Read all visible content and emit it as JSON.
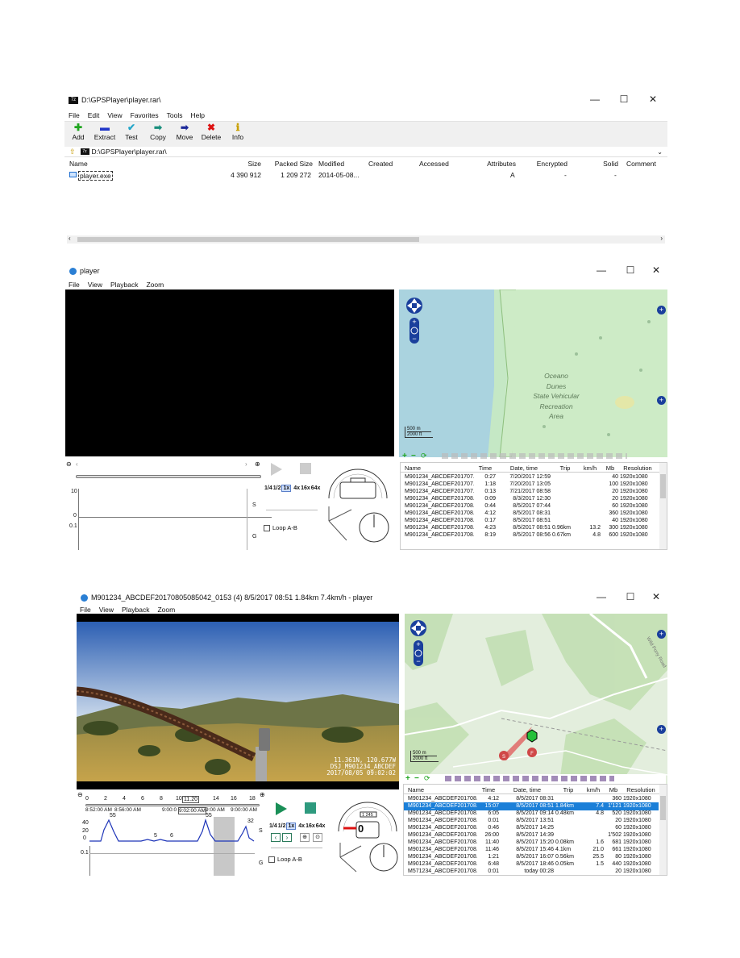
{
  "rar_window": {
    "title": "D:\\GPSPlayer\\player.rar\\",
    "menu": [
      "File",
      "Edit",
      "View",
      "Favorites",
      "Tools",
      "Help"
    ],
    "toolbar": [
      {
        "label": "Add",
        "icon": "plus-icon",
        "glyph": "✚",
        "color": "#1fa51f"
      },
      {
        "label": "Extract",
        "icon": "minus-icon",
        "glyph": "▬",
        "color": "#2036c8"
      },
      {
        "label": "Test",
        "icon": "check-icon",
        "glyph": "✔",
        "color": "#23a6c9"
      },
      {
        "label": "Copy",
        "icon": "copy-arrow-icon",
        "glyph": "➡",
        "color": "#1a8f7d"
      },
      {
        "label": "Move",
        "icon": "move-arrow-icon",
        "glyph": "➡",
        "color": "#1d2a9a"
      },
      {
        "label": "Delete",
        "icon": "delete-x-icon",
        "glyph": "✖",
        "color": "#d11"
      },
      {
        "label": "Info",
        "icon": "info-icon",
        "glyph": "ℹ",
        "color": "#c8a000"
      }
    ],
    "path": "D:\\GPSPlayer\\player.rar\\",
    "columns": [
      "Name",
      "Size",
      "Packed Size",
      "Modified",
      "Created",
      "Accessed",
      "Attributes",
      "Encrypted",
      "Solid",
      "Comment"
    ],
    "file": {
      "name": "player.exe",
      "size": "4 390 912",
      "packed": "1 209 272",
      "modified": "2014-05-08...",
      "attributes": "A",
      "encrypted": "-",
      "solid": "-"
    }
  },
  "player1": {
    "title": "player",
    "menu": [
      "File",
      "View",
      "Playback",
      "Zoom"
    ],
    "map_labels": [
      "Oceano",
      "Dunes",
      "State Vehicular",
      "Recreation",
      "Area"
    ],
    "scale": [
      "500 m",
      "2000 ft"
    ],
    "speeds": [
      "1/4",
      "1/2",
      "1x",
      "4x",
      "16x",
      "64x"
    ],
    "loop_label": "Loop A-B",
    "chart_s_max": "10",
    "chart_s_min": "0",
    "chart_g_max": "0.1",
    "chart_s_label": "S",
    "chart_g_label": "G",
    "list_columns": [
      "Name",
      "Time",
      "Date, time",
      "Trip",
      "km/h",
      "Mb",
      "Resolution"
    ],
    "rows": [
      {
        "name": "M901234_ABCDEF201707...",
        "time": "0:27",
        "date": "7/20/2017 12:59",
        "trip": "",
        "kmh": "",
        "mb": "40",
        "res": "1920x1080"
      },
      {
        "name": "M901234_ABCDEF201707...",
        "time": "1:18",
        "date": "7/20/2017 13:05",
        "trip": "",
        "kmh": "",
        "mb": "100",
        "res": "1920x1080"
      },
      {
        "name": "M901234_ABCDEF201707...",
        "time": "0:13",
        "date": "7/21/2017 08:58",
        "trip": "",
        "kmh": "",
        "mb": "20",
        "res": "1920x1080"
      },
      {
        "name": "M901234_ABCDEF201708...",
        "time": "0:09",
        "date": "8/3/2017 12:30",
        "trip": "",
        "kmh": "",
        "mb": "20",
        "res": "1920x1080"
      },
      {
        "name": "M901234_ABCDEF201708...",
        "time": "0:44",
        "date": "8/5/2017 07:44",
        "trip": "",
        "kmh": "",
        "mb": "60",
        "res": "1920x1080"
      },
      {
        "name": "M901234_ABCDEF201708...",
        "time": "4:12",
        "date": "8/5/2017 08:31",
        "trip": "",
        "kmh": "",
        "mb": "360",
        "res": "1920x1080"
      },
      {
        "name": "M901234_ABCDEF201708...",
        "time": "0:17",
        "date": "8/5/2017 08:51",
        "trip": "",
        "kmh": "",
        "mb": "40",
        "res": "1920x1080"
      },
      {
        "name": "M901234_ABCDEF201708...",
        "time": "4:23",
        "date": "8/5/2017 08:51",
        "trip": "0.96km",
        "kmh": "13.2",
        "mb": "300",
        "res": "1920x1080"
      },
      {
        "name": "M901234_ABCDEF201708...",
        "time": "8:19",
        "date": "8/5/2017 08:56",
        "trip": "0.67km",
        "kmh": "4.8",
        "mb": "600",
        "res": "1920x1080"
      }
    ]
  },
  "player2": {
    "title": "M901234_ABCDEF20170805085042_0153 (4)   8/5/2017 08:51   1.84km   7.4km/h  - player",
    "menu": [
      "File",
      "View",
      "Playback",
      "Zoom"
    ],
    "overlay_line1": "11.361N, 120.677W",
    "overlay_line2": "DSJ_M901234_ABCDEF",
    "overlay_line3": "2017/08/05 09:02:02",
    "road_label": "Wild Pony Road",
    "scale": [
      "500 m",
      "2000 ft"
    ],
    "speedo_value": "0",
    "odo_value": "1 245",
    "ticks": [
      "0",
      "2",
      "4",
      "6",
      "8",
      "10",
      "11.20",
      "14",
      "16",
      "18"
    ],
    "times": [
      "8:52:00 AM",
      "8:56:00 AM",
      "9:00:0",
      "9:02:00 AM",
      "9:00 AM",
      "9:00:00 AM"
    ],
    "peaks": [
      "55",
      "5",
      "6",
      "55",
      "32"
    ],
    "chart_s_ticks": [
      "40",
      "20",
      "0"
    ],
    "chart_g_max": "0.1",
    "chart_s_label": "S",
    "chart_g_label": "G",
    "speeds": [
      "1/4",
      "1/2",
      "1x",
      "4x",
      "16x",
      "64x"
    ],
    "loop_label": "Loop A-B",
    "list_columns": [
      "Name",
      "Time",
      "Date, time",
      "Trip",
      "km/h",
      "Mb",
      "Resolution"
    ],
    "rows": [
      {
        "name": "M901234_ABCDEF201708...",
        "time": "4:12",
        "date": "8/5/2017 08:31",
        "trip": "",
        "kmh": "",
        "mb": "360",
        "res": "1920x1080",
        "sel": false
      },
      {
        "name": "M901234_ABCDEF201708...",
        "time": "15:07",
        "date": "8/5/2017 08:51",
        "trip": "1.84km",
        "kmh": "7.4",
        "mb": "1'121",
        "res": "1920x1080",
        "sel": true
      },
      {
        "name": "M901234_ABCDEF201708...",
        "time": "6:05",
        "date": "8/5/2017 09:14",
        "trip": "0.48km",
        "kmh": "4.8",
        "mb": "520",
        "res": "1920x1080",
        "sel": false
      },
      {
        "name": "M901234_ABCDEF201708...",
        "time": "0:01",
        "date": "8/5/2017 13:51",
        "trip": "",
        "kmh": "",
        "mb": "20",
        "res": "1920x1080",
        "sel": false
      },
      {
        "name": "M901234_ABCDEF201708...",
        "time": "0:46",
        "date": "8/5/2017 14:25",
        "trip": "",
        "kmh": "",
        "mb": "60",
        "res": "1920x1080",
        "sel": false
      },
      {
        "name": "M901234_ABCDEF201708...",
        "time": "26:00",
        "date": "8/5/2017 14:39",
        "trip": "",
        "kmh": "",
        "mb": "1'502",
        "res": "1920x1080",
        "sel": false
      },
      {
        "name": "M901234_ABCDEF201708...",
        "time": "11:40",
        "date": "8/5/2017 15:20",
        "trip": "0.08km",
        "kmh": "1.6",
        "mb": "681",
        "res": "1920x1080",
        "sel": false
      },
      {
        "name": "M901234_ABCDEF201708...",
        "time": "11:46",
        "date": "8/5/2017 15:46",
        "trip": "4.1km",
        "kmh": "21.0",
        "mb": "661",
        "res": "1920x1080",
        "sel": false
      },
      {
        "name": "M901234_ABCDEF201708...",
        "time": "1:21",
        "date": "8/5/2017 16:07",
        "trip": "0.56km",
        "kmh": "25.5",
        "mb": "80",
        "res": "1920x1080",
        "sel": false
      },
      {
        "name": "M901234_ABCDEF201708...",
        "time": "6:48",
        "date": "8/5/2017 18:46",
        "trip": "0.05km",
        "kmh": "1.5",
        "mb": "440",
        "res": "1920x1080",
        "sel": false
      },
      {
        "name": "M571234_ABCDEF201708...",
        "time": "0:01",
        "date": "today 00:28",
        "trip": "",
        "kmh": "",
        "mb": "20",
        "res": "1920x1080",
        "sel": false
      }
    ]
  }
}
